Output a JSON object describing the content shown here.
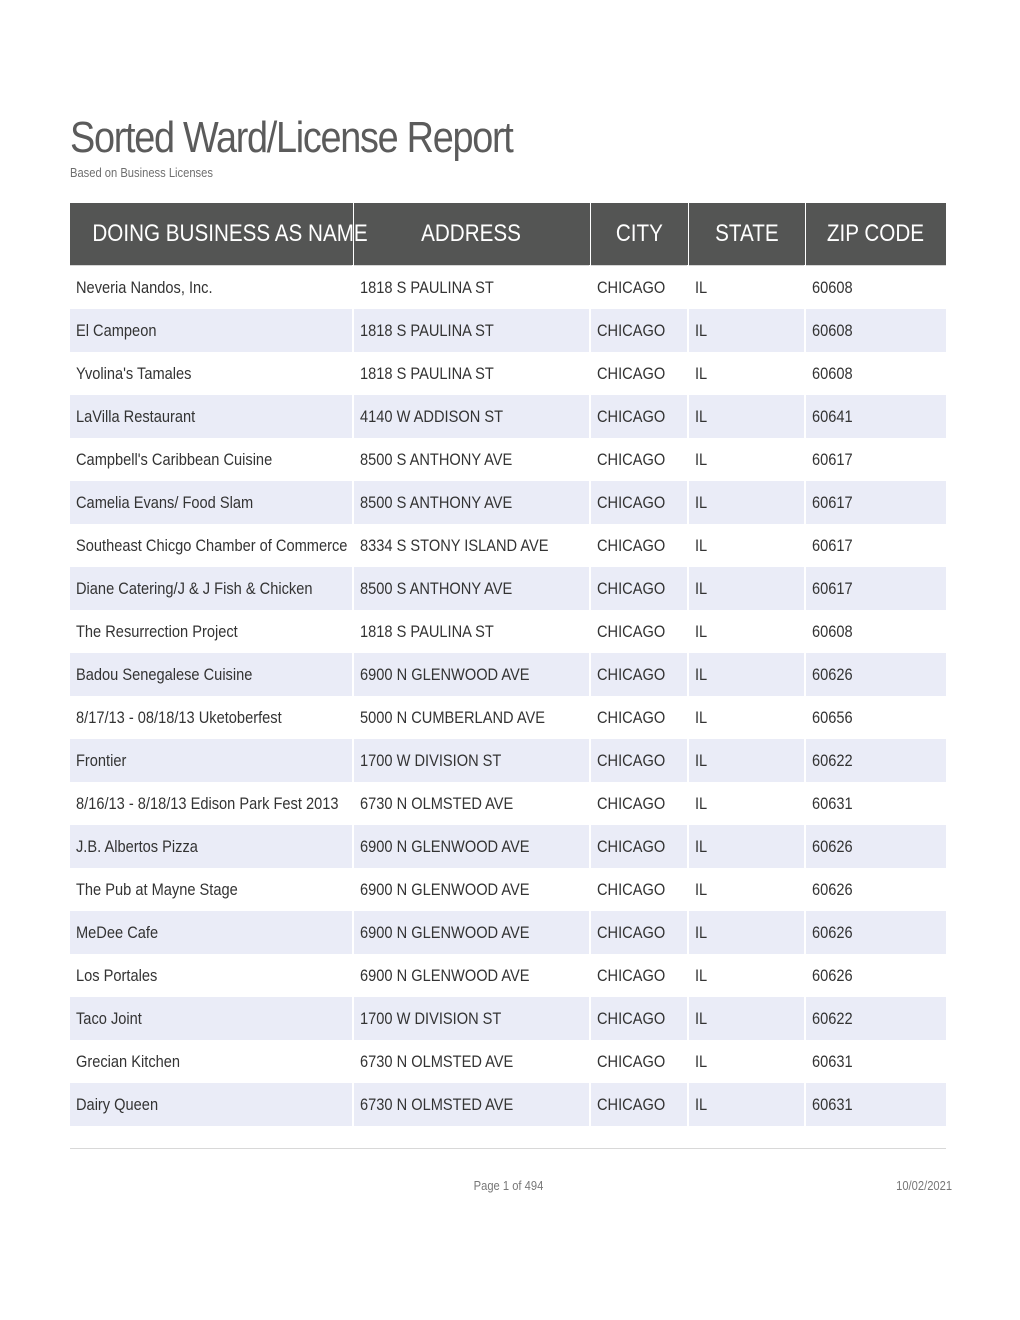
{
  "report": {
    "title": "Sorted Ward/License Report",
    "subtitle": "Based on Business Licenses"
  },
  "colors": {
    "header_background": "#545554",
    "header_text": "#ffffff",
    "stripe_background": "#eaecf7",
    "body_text": "#333333"
  },
  "table": {
    "columns": [
      "DOING BUSINESS AS NAME",
      "ADDRESS",
      "CITY",
      "STATE",
      "ZIP CODE"
    ],
    "rows": [
      {
        "name": "Neveria Nandos, Inc.",
        "address": "1818 S PAULINA ST",
        "city": "CHICAGO",
        "state": "IL",
        "zip": "60608"
      },
      {
        "name": "El Campeon",
        "address": "1818 S PAULINA ST",
        "city": "CHICAGO",
        "state": "IL",
        "zip": "60608"
      },
      {
        "name": "Yvolina's Tamales",
        "address": "1818 S PAULINA ST",
        "city": "CHICAGO",
        "state": "IL",
        "zip": "60608"
      },
      {
        "name": "LaVilla Restaurant",
        "address": "4140 W ADDISON ST",
        "city": "CHICAGO",
        "state": "IL",
        "zip": "60641"
      },
      {
        "name": "Campbell's Caribbean Cuisine",
        "address": "8500 S ANTHONY AVE",
        "city": "CHICAGO",
        "state": "IL",
        "zip": "60617"
      },
      {
        "name": "Camelia Evans/ Food Slam",
        "address": "8500 S ANTHONY AVE",
        "city": "CHICAGO",
        "state": "IL",
        "zip": "60617"
      },
      {
        "name": "Southeast Chicgo Chamber of Commerce",
        "address": "8334 S STONY ISLAND AVE",
        "city": "CHICAGO",
        "state": "IL",
        "zip": "60617"
      },
      {
        "name": "Diane Catering/J & J Fish & Chicken",
        "address": "8500 S ANTHONY AVE",
        "city": "CHICAGO",
        "state": "IL",
        "zip": "60617"
      },
      {
        "name": "The Resurrection Project",
        "address": "1818 S PAULINA ST",
        "city": "CHICAGO",
        "state": "IL",
        "zip": "60608"
      },
      {
        "name": "Badou Senegalese Cuisine",
        "address": "6900 N GLENWOOD AVE",
        "city": "CHICAGO",
        "state": "IL",
        "zip": "60626"
      },
      {
        "name": "8/17/13 - 08/18/13 Uketoberfest",
        "address": "5000 N CUMBERLAND AVE",
        "city": "CHICAGO",
        "state": "IL",
        "zip": "60656"
      },
      {
        "name": "Frontier",
        "address": "1700 W DIVISION ST",
        "city": "CHICAGO",
        "state": "IL",
        "zip": "60622"
      },
      {
        "name": "8/16/13 - 8/18/13 Edison Park Fest 2013",
        "address": "6730 N OLMSTED AVE",
        "city": "CHICAGO",
        "state": "IL",
        "zip": "60631"
      },
      {
        "name": "J.B. Albertos Pizza",
        "address": "6900 N GLENWOOD AVE",
        "city": "CHICAGO",
        "state": "IL",
        "zip": "60626"
      },
      {
        "name": "The Pub at Mayne Stage",
        "address": "6900 N GLENWOOD AVE",
        "city": "CHICAGO",
        "state": "IL",
        "zip": "60626"
      },
      {
        "name": "MeDee Cafe",
        "address": "6900 N GLENWOOD AVE",
        "city": "CHICAGO",
        "state": "IL",
        "zip": "60626"
      },
      {
        "name": "Los Portales",
        "address": "6900 N GLENWOOD AVE",
        "city": "CHICAGO",
        "state": "IL",
        "zip": "60626"
      },
      {
        "name": "Taco Joint",
        "address": "1700 W DIVISION ST",
        "city": "CHICAGO",
        "state": "IL",
        "zip": "60622"
      },
      {
        "name": "Grecian Kitchen",
        "address": "6730 N OLMSTED AVE",
        "city": "CHICAGO",
        "state": "IL",
        "zip": "60631"
      },
      {
        "name": "Dairy Queen",
        "address": "6730 N OLMSTED AVE",
        "city": "CHICAGO",
        "state": "IL",
        "zip": "60631"
      }
    ]
  },
  "footer": {
    "page_label": "Page 1 of 494",
    "date": "10/02/2021"
  }
}
